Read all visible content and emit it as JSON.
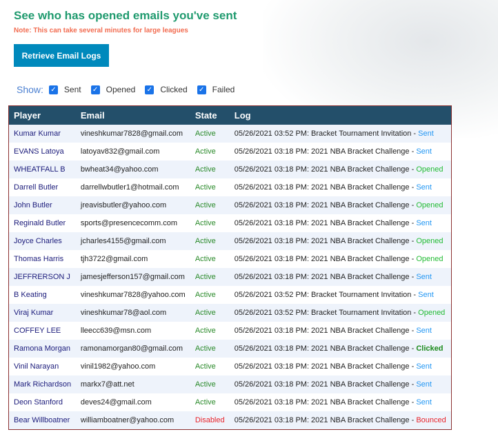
{
  "title": "See who has opened emails you've sent",
  "note": "Note: This can take several minutes for large leagues",
  "retrieve_button": "Retrieve Email Logs",
  "filters": {
    "label": "Show:",
    "options": [
      {
        "label": "Sent",
        "checked": true
      },
      {
        "label": "Opened",
        "checked": true
      },
      {
        "label": "Clicked",
        "checked": true
      },
      {
        "label": "Failed",
        "checked": true
      }
    ]
  },
  "table": {
    "headers": [
      "Player",
      "Email",
      "State",
      "Log"
    ],
    "rows": [
      {
        "player": "Kumar Kumar",
        "email": "vineshkumar7828@gmail.com",
        "state": "Active",
        "log": "05/26/2021 03:52 PM: Bracket Tournament Invitation - ",
        "status": "Sent"
      },
      {
        "player": "EVANS Latoya",
        "email": "latoyav832@gmail.com",
        "state": "Active",
        "log": "05/26/2021 03:18 PM: 2021 NBA Bracket Challenge - ",
        "status": "Sent"
      },
      {
        "player": "WHEATFALL B",
        "email": "bwheat34@yahoo.com",
        "state": "Active",
        "log": "05/26/2021 03:18 PM: 2021 NBA Bracket Challenge - ",
        "status": "Opened"
      },
      {
        "player": "Darrell Butler",
        "email": "darrellwbutler1@hotmail.com",
        "state": "Active",
        "log": "05/26/2021 03:18 PM: 2021 NBA Bracket Challenge - ",
        "status": "Sent"
      },
      {
        "player": "John Butler",
        "email": "jreavisbutler@yahoo.com",
        "state": "Active",
        "log": "05/26/2021 03:18 PM: 2021 NBA Bracket Challenge - ",
        "status": "Opened"
      },
      {
        "player": "Reginald Butler",
        "email": "sports@presencecomm.com",
        "state": "Active",
        "log": "05/26/2021 03:18 PM: 2021 NBA Bracket Challenge - ",
        "status": "Sent"
      },
      {
        "player": "Joyce Charles",
        "email": "jcharles4155@gmail.com",
        "state": "Active",
        "log": "05/26/2021 03:18 PM: 2021 NBA Bracket Challenge - ",
        "status": "Opened"
      },
      {
        "player": "Thomas Harris",
        "email": "tjh3722@gmail.com",
        "state": "Active",
        "log": "05/26/2021 03:18 PM: 2021 NBA Bracket Challenge - ",
        "status": "Opened"
      },
      {
        "player": "JEFFRERSON J",
        "email": "jamesjefferson157@gmail.com",
        "state": "Active",
        "log": "05/26/2021 03:18 PM: 2021 NBA Bracket Challenge - ",
        "status": "Sent"
      },
      {
        "player": "B Keating",
        "email": "vineshkumar7828@yahoo.com",
        "state": "Active",
        "log": "05/26/2021 03:52 PM: Bracket Tournament Invitation - ",
        "status": "Sent"
      },
      {
        "player": "Viraj Kumar",
        "email": "vineshkumar78@aol.com",
        "state": "Active",
        "log": "05/26/2021 03:52 PM: Bracket Tournament Invitation - ",
        "status": "Opened"
      },
      {
        "player": "COFFEY LEE",
        "email": "lleecc639@msn.com",
        "state": "Active",
        "log": "05/26/2021 03:18 PM: 2021 NBA Bracket Challenge - ",
        "status": "Sent"
      },
      {
        "player": "Ramona Morgan",
        "email": "ramonamorgan80@gmail.com",
        "state": "Active",
        "log": "05/26/2021 03:18 PM: 2021 NBA Bracket Challenge - ",
        "status": "Clicked"
      },
      {
        "player": "Vinil Narayan",
        "email": "vinil1982@yahoo.com",
        "state": "Active",
        "log": "05/26/2021 03:18 PM: 2021 NBA Bracket Challenge - ",
        "status": "Sent"
      },
      {
        "player": "Mark Richardson",
        "email": "markx7@att.net",
        "state": "Active",
        "log": "05/26/2021 03:18 PM: 2021 NBA Bracket Challenge - ",
        "status": "Sent"
      },
      {
        "player": "Deon Stanford",
        "email": "deves24@gmail.com",
        "state": "Active",
        "log": "05/26/2021 03:18 PM: 2021 NBA Bracket Challenge - ",
        "status": "Sent"
      },
      {
        "player": "Bear Willboatner",
        "email": "williamboatner@yahoo.com",
        "state": "Disabled",
        "log": "05/26/2021 03:18 PM: 2021 NBA Bracket Challenge - ",
        "status": "Bounced"
      }
    ]
  },
  "colors": {
    "title": "#1f9a6e",
    "note": "#f26b4f",
    "button": "#0089bc",
    "header": "#234f6a",
    "sent": "#2196f3",
    "opened": "#22bb33",
    "clicked": "#1b8a1b",
    "bounced": "#e8232a"
  }
}
